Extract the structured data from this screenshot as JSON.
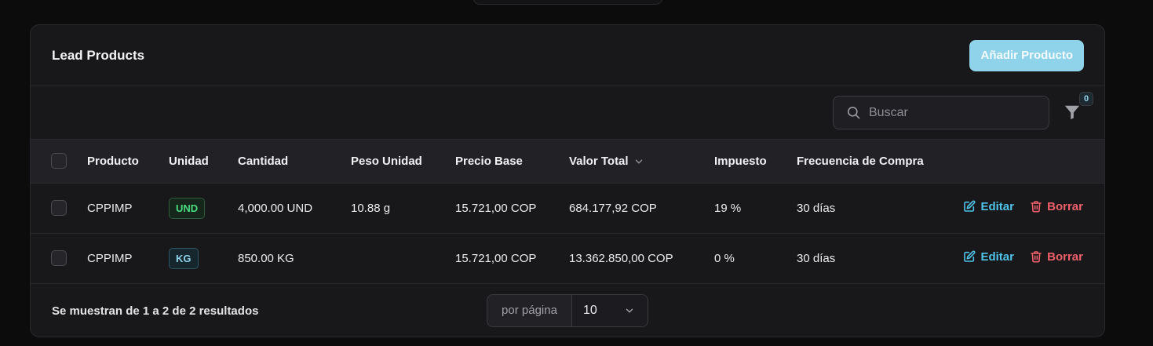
{
  "card": {
    "title": "Lead Products",
    "add_button": "Añadir Producto"
  },
  "toolbar": {
    "search_placeholder": "Buscar",
    "filter_count": "0"
  },
  "table": {
    "columns": [
      "Producto",
      "Unidad",
      "Cantidad",
      "Peso Unidad",
      "Precio Base",
      "Valor Total",
      "Impuesto",
      "Frecuencia de Compra"
    ],
    "rows": [
      {
        "producto": "CPPIMP",
        "unidad": "UND",
        "cantidad": "4,000.00 UND",
        "peso": "10.88 g",
        "precio": "15.721,00 COP",
        "total": "684.177,92 COP",
        "impuesto": "19 %",
        "frecuencia": "30 días",
        "edit_label": "Editar",
        "delete_label": "Borrar"
      },
      {
        "producto": "CPPIMP",
        "unidad": "KG",
        "cantidad": "850.00 KG",
        "peso": "",
        "precio": "15.721,00 COP",
        "total": "13.362.850,00 COP",
        "impuesto": "0 %",
        "frecuencia": "30 días",
        "edit_label": "Editar",
        "delete_label": "Borrar"
      }
    ]
  },
  "footer": {
    "results_text": "Se muestran de 1 a 2 de 2 resultados",
    "per_page_label": "por página",
    "per_page_value": "10"
  },
  "colors": {
    "accent": "#8fd3ea",
    "edit": "#4fc3e8",
    "delete": "#f0606a",
    "badge_und": "#4ade80"
  }
}
